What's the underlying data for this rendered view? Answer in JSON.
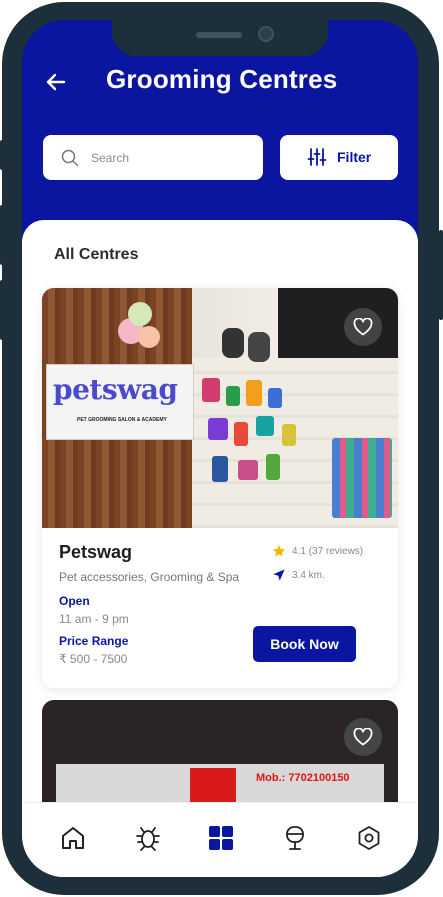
{
  "header": {
    "title": "Grooming Centres",
    "back_icon": "arrow-left-icon"
  },
  "search": {
    "placeholder": "Search",
    "icon": "search-icon"
  },
  "filter": {
    "label": "Filter",
    "icon": "sliders-icon"
  },
  "section": {
    "title": "All Centres"
  },
  "centres": [
    {
      "name": "Petswag",
      "sign_text": "petswag",
      "sign_subtext": "PET GROOMING SALON & ACADEMY",
      "category": "Pet accessories, Grooming & Spa",
      "status": "Open",
      "hours": "11 am - 9 pm",
      "price_label": "Price Range",
      "price": "₹ 500 - 7500",
      "rating": "4.1 (37 reviews)",
      "distance": "3.4 km.",
      "book_label": "Book Now"
    },
    {
      "photo_text": "Mob.: 7702100150"
    }
  ],
  "nav": {
    "items": [
      {
        "icon": "home-icon",
        "active": false
      },
      {
        "icon": "bug-icon",
        "active": false
      },
      {
        "icon": "grid-icon",
        "active": true
      },
      {
        "icon": "microphone-icon",
        "active": false
      },
      {
        "icon": "settings-icon",
        "active": false
      }
    ]
  },
  "colors": {
    "primary": "#0a16a0",
    "star": "#f2b705",
    "frame": "#1d2f3a"
  }
}
